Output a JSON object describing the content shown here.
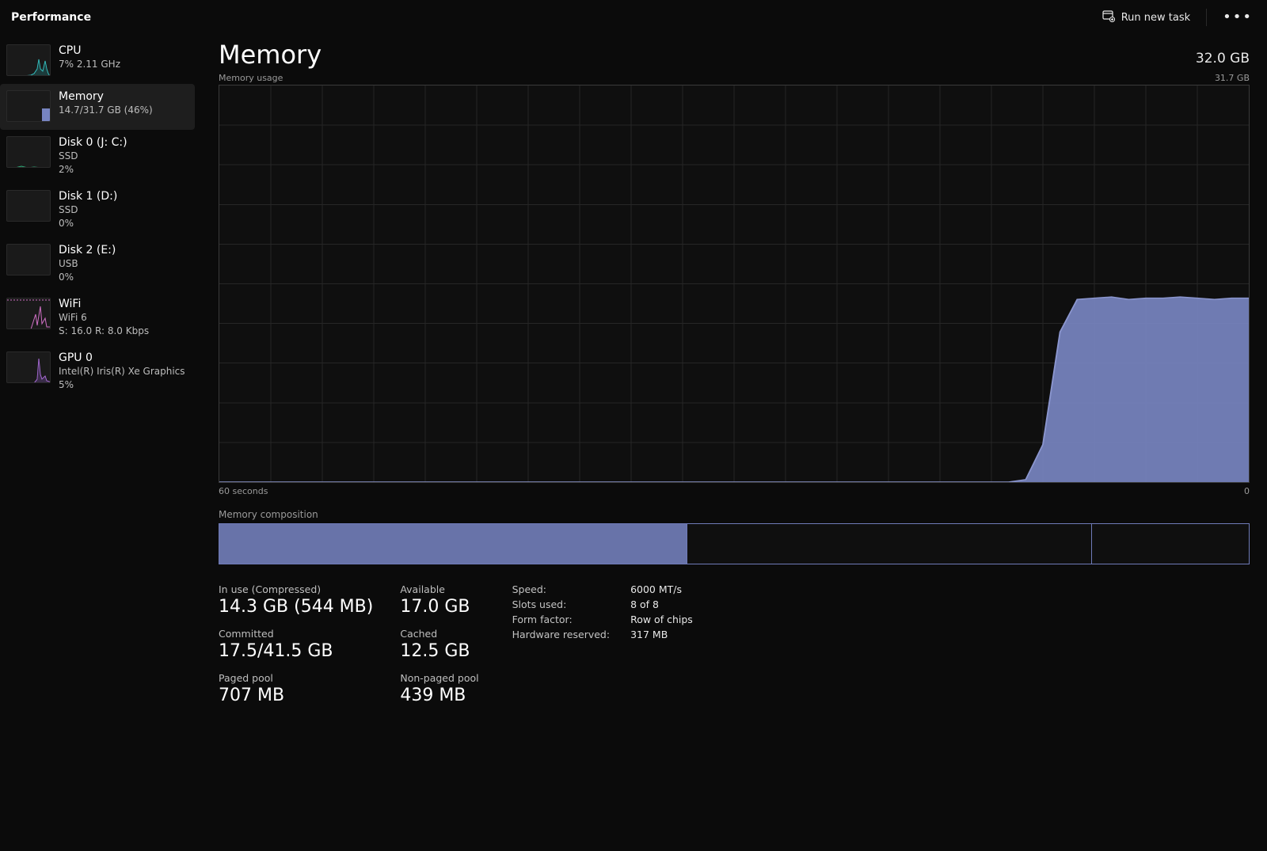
{
  "header": {
    "title": "Performance",
    "run_new_task": "Run new task"
  },
  "sidebar": {
    "items": [
      {
        "title": "CPU",
        "line1": "7%  2.11 GHz",
        "line2": "",
        "thumb": "cpu"
      },
      {
        "title": "Memory",
        "line1": "14.7/31.7 GB (46%)",
        "line2": "",
        "thumb": "memory",
        "selected": true
      },
      {
        "title": "Disk 0 (J: C:)",
        "line1": "SSD",
        "line2": "2%",
        "thumb": "disk"
      },
      {
        "title": "Disk 1 (D:)",
        "line1": "SSD",
        "line2": "0%",
        "thumb": "disk"
      },
      {
        "title": "Disk 2 (E:)",
        "line1": "USB",
        "line2": "0%",
        "thumb": "disk"
      },
      {
        "title": "WiFi",
        "line1": "WiFi 6",
        "line2": "S: 16.0 R: 8.0 Kbps",
        "thumb": "wifi"
      },
      {
        "title": "GPU 0",
        "line1": "Intel(R) Iris(R) Xe Graphics",
        "line2": "5%",
        "thumb": "gpu"
      }
    ]
  },
  "main": {
    "title": "Memory",
    "capacity": "32.0 GB",
    "usage_label": "Memory usage",
    "usage_max_label": "31.7 GB",
    "x_left": "60 seconds",
    "x_right": "0",
    "composition_label": "Memory composition",
    "composition": {
      "in_use_pct": 45.4,
      "standby_pct": 39.4,
      "free_pct": 15.2
    },
    "stats": {
      "in_use_label": "In use (Compressed)",
      "in_use_value": "14.3 GB (544 MB)",
      "available_label": "Available",
      "available_value": "17.0 GB",
      "committed_label": "Committed",
      "committed_value": "17.5/41.5 GB",
      "cached_label": "Cached",
      "cached_value": "12.5 GB",
      "paged_label": "Paged pool",
      "paged_value": "707 MB",
      "nonpaged_label": "Non-paged pool",
      "nonpaged_value": "439 MB"
    },
    "specs": {
      "speed_k": "Speed:",
      "speed_v": "6000 MT/s",
      "slots_k": "Slots used:",
      "slots_v": "8 of 8",
      "form_k": "Form factor:",
      "form_v": "Row of chips",
      "hwres_k": "Hardware reserved:",
      "hwres_v": "317 MB"
    }
  },
  "chart_data": {
    "type": "area",
    "title": "Memory usage",
    "xlabel": "seconds ago",
    "ylabel": "GB",
    "xlim": [
      60,
      0
    ],
    "ylim": [
      0,
      31.7
    ],
    "x": [
      60,
      58,
      56,
      54,
      52,
      50,
      48,
      46,
      44,
      42,
      40,
      38,
      36,
      34,
      32,
      30,
      28,
      26,
      24,
      22,
      20,
      18,
      16,
      14,
      13,
      12,
      11,
      10,
      9,
      8,
      7,
      6,
      5,
      4,
      3,
      2,
      1,
      0
    ],
    "values": [
      0,
      0,
      0,
      0,
      0,
      0,
      0,
      0,
      0,
      0,
      0,
      0,
      0,
      0,
      0,
      0,
      0,
      0,
      0,
      0,
      0,
      0,
      0,
      0,
      0.2,
      3.0,
      12.0,
      14.6,
      14.7,
      14.8,
      14.6,
      14.7,
      14.7,
      14.8,
      14.7,
      14.6,
      14.7,
      14.7
    ],
    "series_name": "Memory usage (GB)"
  }
}
